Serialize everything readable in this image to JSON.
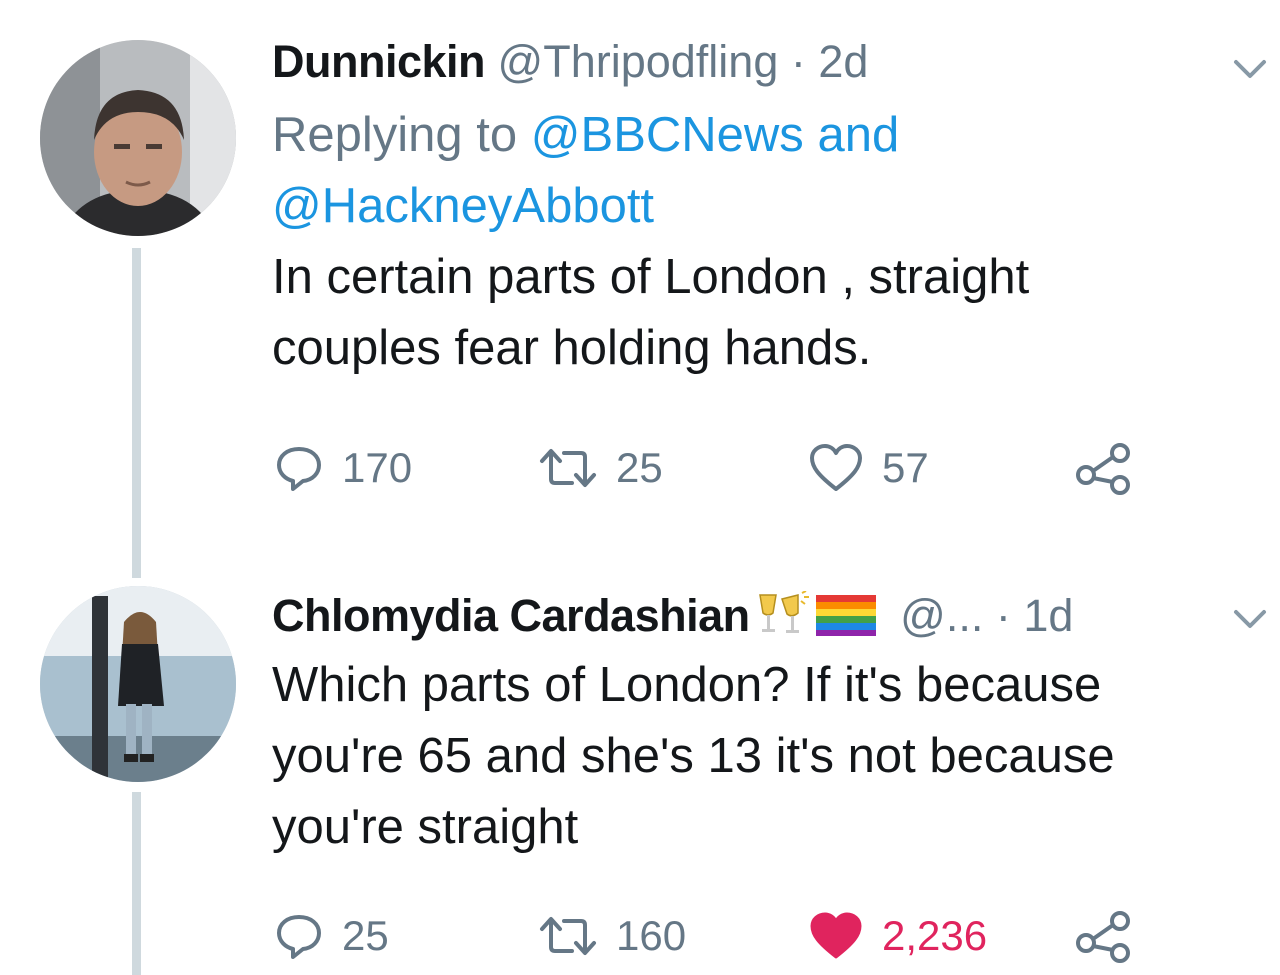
{
  "thread": [
    {
      "display_name": "Dunnickin",
      "handle": "@Thripodfling",
      "separator": "·",
      "time": "2d",
      "replying_prefix": "Replying to",
      "reply_to_1": "@BBCNews",
      "reply_joiner": "and",
      "reply_to_2": "@HackneyAbbott",
      "text_line1": "In certain parts of London , straight",
      "text_line2": "couples fear holding hands.",
      "replies": "170",
      "retweets": "25",
      "likes": "57",
      "liked": false
    },
    {
      "display_name": "Chlomydia Cardashian",
      "name_emojis": [
        "clinking-glasses-icon",
        "rainbow-flag-icon"
      ],
      "handle": "@...",
      "separator": "·",
      "time": "1d",
      "text_line1": "Which parts of London? If it's because",
      "text_line2": "you're 65 and she's 13 it's not because",
      "text_line3": "you're straight",
      "replies": "25",
      "retweets": "160",
      "likes": "2,236",
      "liked": true
    }
  ],
  "colors": {
    "text": "#14171a",
    "muted": "#657786",
    "link": "#1b95e0",
    "like_active": "#e0245e",
    "thread_line": "#cfd9de"
  }
}
